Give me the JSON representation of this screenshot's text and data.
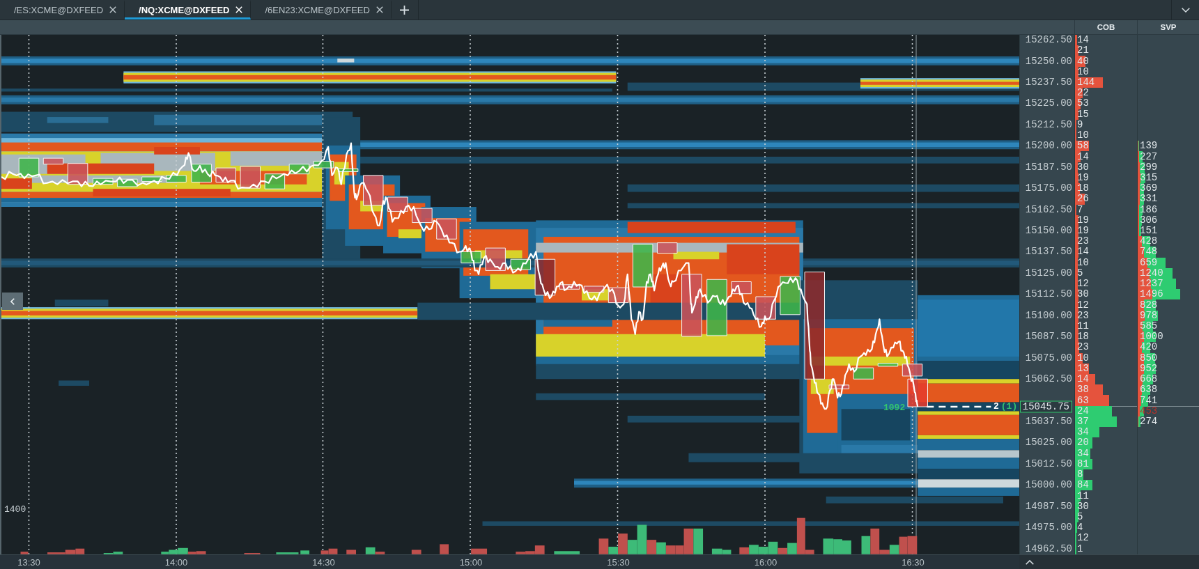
{
  "tabs": [
    {
      "label": "/ES:XCME@DXFEED",
      "selected": false
    },
    {
      "label": "/NQ:XCME@DXFEED",
      "selected": true
    },
    {
      "label": "/6EN23:XCME@DXFEED",
      "selected": false
    }
  ],
  "chart": {
    "volume_scale": "1400",
    "volume_label": "1092",
    "marker_size": "2",
    "marker_count": "(1)"
  },
  "time_axis": [
    "13:30",
    "14:00",
    "14:30",
    "15:00",
    "15:30",
    "16:00",
    "16:30"
  ],
  "ladder": {
    "cob_header": "COB",
    "svp_header": "SVP",
    "rows": [
      {
        "price": "15262.50",
        "cob": {
          "value": "14",
          "kind": "ask",
          "level": 0.03
        }
      },
      {
        "cob": {
          "value": "21",
          "kind": "ask",
          "level": 0.06
        }
      },
      {
        "price": "15250.00",
        "cob": {
          "value": "40",
          "kind": "ask",
          "level": 0.17
        }
      },
      {
        "cob": {
          "value": "10",
          "kind": "ask",
          "level": 0.06
        }
      },
      {
        "price": "15237.50",
        "cob": {
          "value": "144",
          "kind": "ask",
          "level": 0.45
        }
      },
      {
        "cob": {
          "value": "22",
          "kind": "ask",
          "level": 0.12
        }
      },
      {
        "price": "15225.00",
        "cob": {
          "value": "53",
          "kind": "ask",
          "level": 0.09
        }
      },
      {
        "cob": {
          "value": "15",
          "kind": "ask",
          "level": 0.06
        }
      },
      {
        "price": "15212.50",
        "cob": {
          "value": "9",
          "kind": "ask",
          "level": 0.02
        }
      },
      {
        "cob": {
          "value": "10",
          "kind": "ask",
          "level": 0.02
        }
      },
      {
        "price": "15200.00",
        "cob": {
          "value": "58",
          "kind": "ask",
          "level": 0.23
        },
        "svp": {
          "value": "139",
          "level": 0.02,
          "current": false
        }
      },
      {
        "cob": {
          "value": "14",
          "kind": "ask",
          "level": 0.09
        },
        "svp": {
          "value": "227",
          "level": 0.08,
          "current": false
        }
      },
      {
        "price": "15187.50",
        "cob": {
          "value": "30",
          "kind": "ask",
          "level": 0.05
        },
        "svp": {
          "value": "299",
          "level": 0.11,
          "current": false
        }
      },
      {
        "cob": {
          "value": "19",
          "kind": "ask",
          "level": 0.06
        },
        "svp": {
          "value": "315",
          "level": 0.12,
          "current": false
        }
      },
      {
        "price": "15175.00",
        "cob": {
          "value": "18",
          "kind": "ask",
          "level": 0.08
        },
        "svp": {
          "value": "369",
          "level": 0.1,
          "current": false
        }
      },
      {
        "cob": {
          "value": "26",
          "kind": "ask",
          "level": 0.16
        },
        "svp": {
          "value": "331",
          "level": 0.1,
          "current": false
        }
      },
      {
        "price": "15162.50",
        "cob": {
          "value": "7",
          "kind": "ask",
          "level": 0.02
        },
        "svp": {
          "value": "186",
          "level": 0.08,
          "current": false
        }
      },
      {
        "cob": {
          "value": "19",
          "kind": "ask",
          "level": 0.06
        },
        "svp": {
          "value": "306",
          "level": 0.07,
          "current": false
        }
      },
      {
        "price": "15150.00",
        "cob": {
          "value": "19",
          "kind": "ask",
          "level": 0.06
        },
        "svp": {
          "value": "151",
          "level": 0.06,
          "current": false
        }
      },
      {
        "cob": {
          "value": "23",
          "kind": "ask",
          "level": 0.06
        },
        "svp": {
          "value": "428",
          "level": 0.2,
          "current": false
        }
      },
      {
        "price": "15137.50",
        "cob": {
          "value": "14",
          "kind": "ask",
          "level": 0.06
        },
        "svp": {
          "value": "748",
          "level": 0.3,
          "current": false
        }
      },
      {
        "cob": {
          "value": "10",
          "kind": "ask",
          "level": 0.04
        },
        "svp": {
          "value": "659",
          "level": 0.45,
          "current": false
        }
      },
      {
        "price": "15125.00",
        "cob": {
          "value": "5",
          "kind": "ask",
          "level": 0.04
        },
        "svp": {
          "value": "1240",
          "level": 0.57,
          "current": false
        }
      },
      {
        "cob": {
          "value": "12",
          "kind": "ask",
          "level": 0.05
        },
        "svp": {
          "value": "1237",
          "level": 0.62,
          "current": false
        }
      },
      {
        "price": "15112.50",
        "cob": {
          "value": "30",
          "kind": "ask",
          "level": 0.06
        },
        "svp": {
          "value": "1496",
          "level": 0.69,
          "current": false
        }
      },
      {
        "cob": {
          "value": "12",
          "kind": "ask",
          "level": 0.06
        },
        "svp": {
          "value": "828",
          "level": 0.3,
          "current": false
        }
      },
      {
        "price": "15100.00",
        "cob": {
          "value": "23",
          "kind": "ask",
          "level": 0.06
        },
        "svp": {
          "value": "978",
          "level": 0.33,
          "current": false
        }
      },
      {
        "cob": {
          "value": "11",
          "kind": "ask",
          "level": 0.06
        },
        "svp": {
          "value": "585",
          "level": 0.25,
          "current": false
        }
      },
      {
        "price": "15087.50",
        "cob": {
          "value": "18",
          "kind": "ask",
          "level": 0.06
        },
        "svp": {
          "value": "1000",
          "level": 0.3,
          "current": false
        }
      },
      {
        "cob": {
          "value": "23",
          "kind": "ask",
          "level": 0.07
        },
        "svp": {
          "value": "420",
          "level": 0.2,
          "current": false
        }
      },
      {
        "price": "15075.00",
        "cob": {
          "value": "10",
          "kind": "ask",
          "level": 0.12
        },
        "svp": {
          "value": "850",
          "level": 0.28,
          "current": false
        }
      },
      {
        "cob": {
          "value": "13",
          "kind": "ask",
          "level": 0.23
        },
        "svp": {
          "value": "952",
          "level": 0.3,
          "current": false
        }
      },
      {
        "price": "15062.50",
        "cob": {
          "value": "14",
          "kind": "ask",
          "level": 0.33
        },
        "svp": {
          "value": "668",
          "level": 0.25,
          "current": false
        }
      },
      {
        "cob": {
          "value": "38",
          "kind": "ask",
          "level": 0.45
        },
        "svp": {
          "value": "638",
          "level": 0.2,
          "current": false
        }
      },
      {
        "current_price": "15045.75",
        "cob": {
          "value": "63",
          "kind": "ask",
          "level": 0.55
        },
        "svp": {
          "value": "741",
          "level": 0.17,
          "current": false
        }
      },
      {
        "cob": {
          "value": "24",
          "kind": "bid",
          "level": 0.6
        },
        "svp": {
          "value": "453",
          "level": 0.1,
          "current": true
        }
      },
      {
        "price": "15037.50",
        "cob": {
          "value": "37",
          "kind": "bid",
          "level": 0.67
        },
        "svp": {
          "value": "274",
          "level": 0.04,
          "current": false
        }
      },
      {
        "cob": {
          "value": "34",
          "kind": "bid",
          "level": 0.39
        }
      },
      {
        "price": "15025.00",
        "cob": {
          "value": "20",
          "kind": "bid",
          "level": 0.28
        }
      },
      {
        "cob": {
          "value": "34",
          "kind": "bid",
          "level": 0.25
        }
      },
      {
        "price": "15012.50",
        "cob": {
          "value": "81",
          "kind": "bid",
          "level": 0.28
        }
      },
      {
        "cob": {
          "value": "8",
          "kind": "bid",
          "level": 0.14
        }
      },
      {
        "price": "15000.00",
        "cob": {
          "value": "84",
          "kind": "bid",
          "level": 0.28
        }
      },
      {
        "cob": {
          "value": "11",
          "kind": "bid",
          "level": 0.09
        }
      },
      {
        "price": "14987.50",
        "cob": {
          "value": "30",
          "kind": "bid",
          "level": 0.07
        }
      },
      {
        "cob": {
          "value": "5",
          "kind": "bid",
          "level": 0.06
        }
      },
      {
        "price": "14975.00",
        "cob": {
          "value": "4",
          "kind": "bid",
          "level": 0.03
        }
      },
      {
        "cob": {
          "value": "12",
          "kind": "bid",
          "level": 0.02
        }
      },
      {
        "price": "14962.50",
        "cob": {
          "value": "1",
          "kind": "bid",
          "level": 0.02
        }
      }
    ]
  }
}
